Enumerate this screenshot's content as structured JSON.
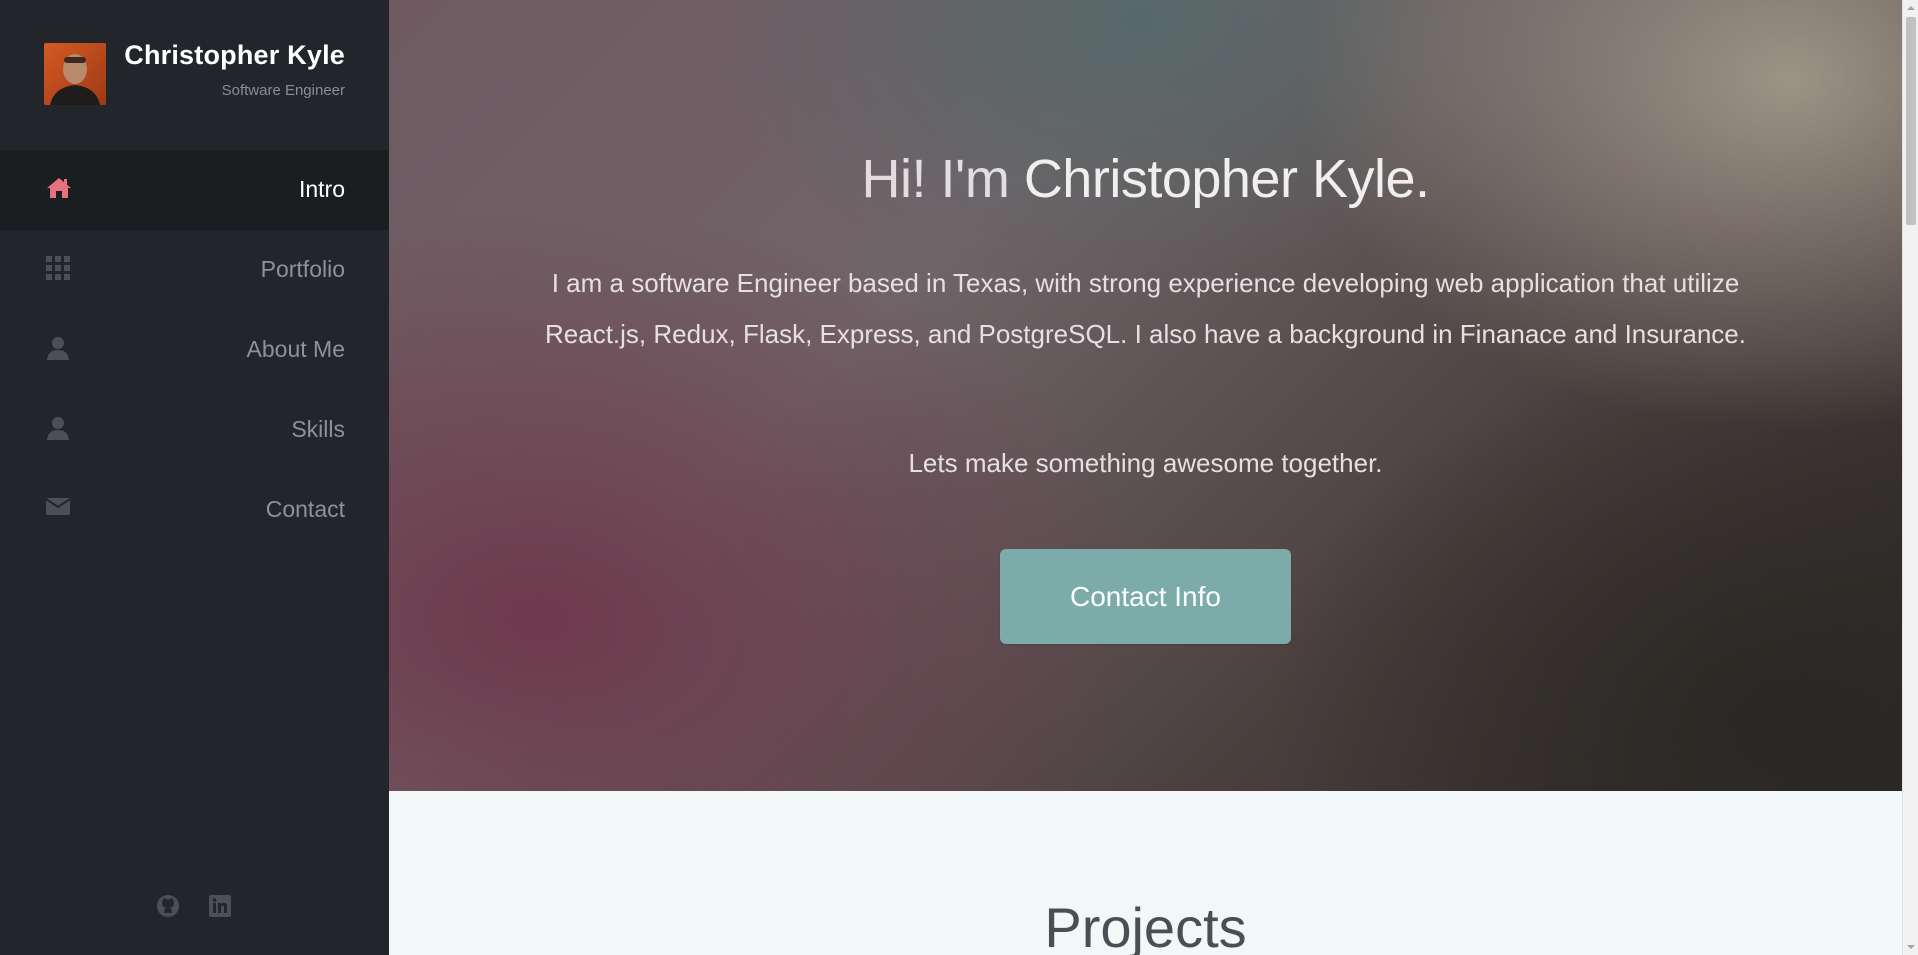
{
  "sidebar": {
    "profile": {
      "name": "Christopher Kyle",
      "role": "Software Engineer"
    },
    "nav": [
      {
        "label": "Intro",
        "icon": "home-icon",
        "active": true
      },
      {
        "label": "Portfolio",
        "icon": "grid-icon",
        "active": false
      },
      {
        "label": "About Me",
        "icon": "user-icon",
        "active": false
      },
      {
        "label": "Skills",
        "icon": "user-icon",
        "active": false
      },
      {
        "label": "Contact",
        "icon": "envelope-icon",
        "active": false
      }
    ],
    "social": [
      {
        "icon": "github-icon"
      },
      {
        "icon": "linkedin-icon"
      }
    ]
  },
  "hero": {
    "greeting": "Hi! I'm",
    "name": "Christopher Kyle.",
    "description": "I am a software Engineer based in Texas, with strong experience developing web application that utilize React.js, Redux, Flask, Express, and PostgreSQL. I also have a background in Finanace and Insurance.",
    "tagline": "Lets make something awesome together.",
    "button_label": "Contact Info"
  },
  "projects": {
    "title": "Projects"
  },
  "colors": {
    "sidebar_bg": "#22262a",
    "active_nav_bg": "#1b1e21",
    "accent_pink": "#e7727f",
    "button_teal": "#7bacaa",
    "icon_gray": "#4c5055"
  }
}
